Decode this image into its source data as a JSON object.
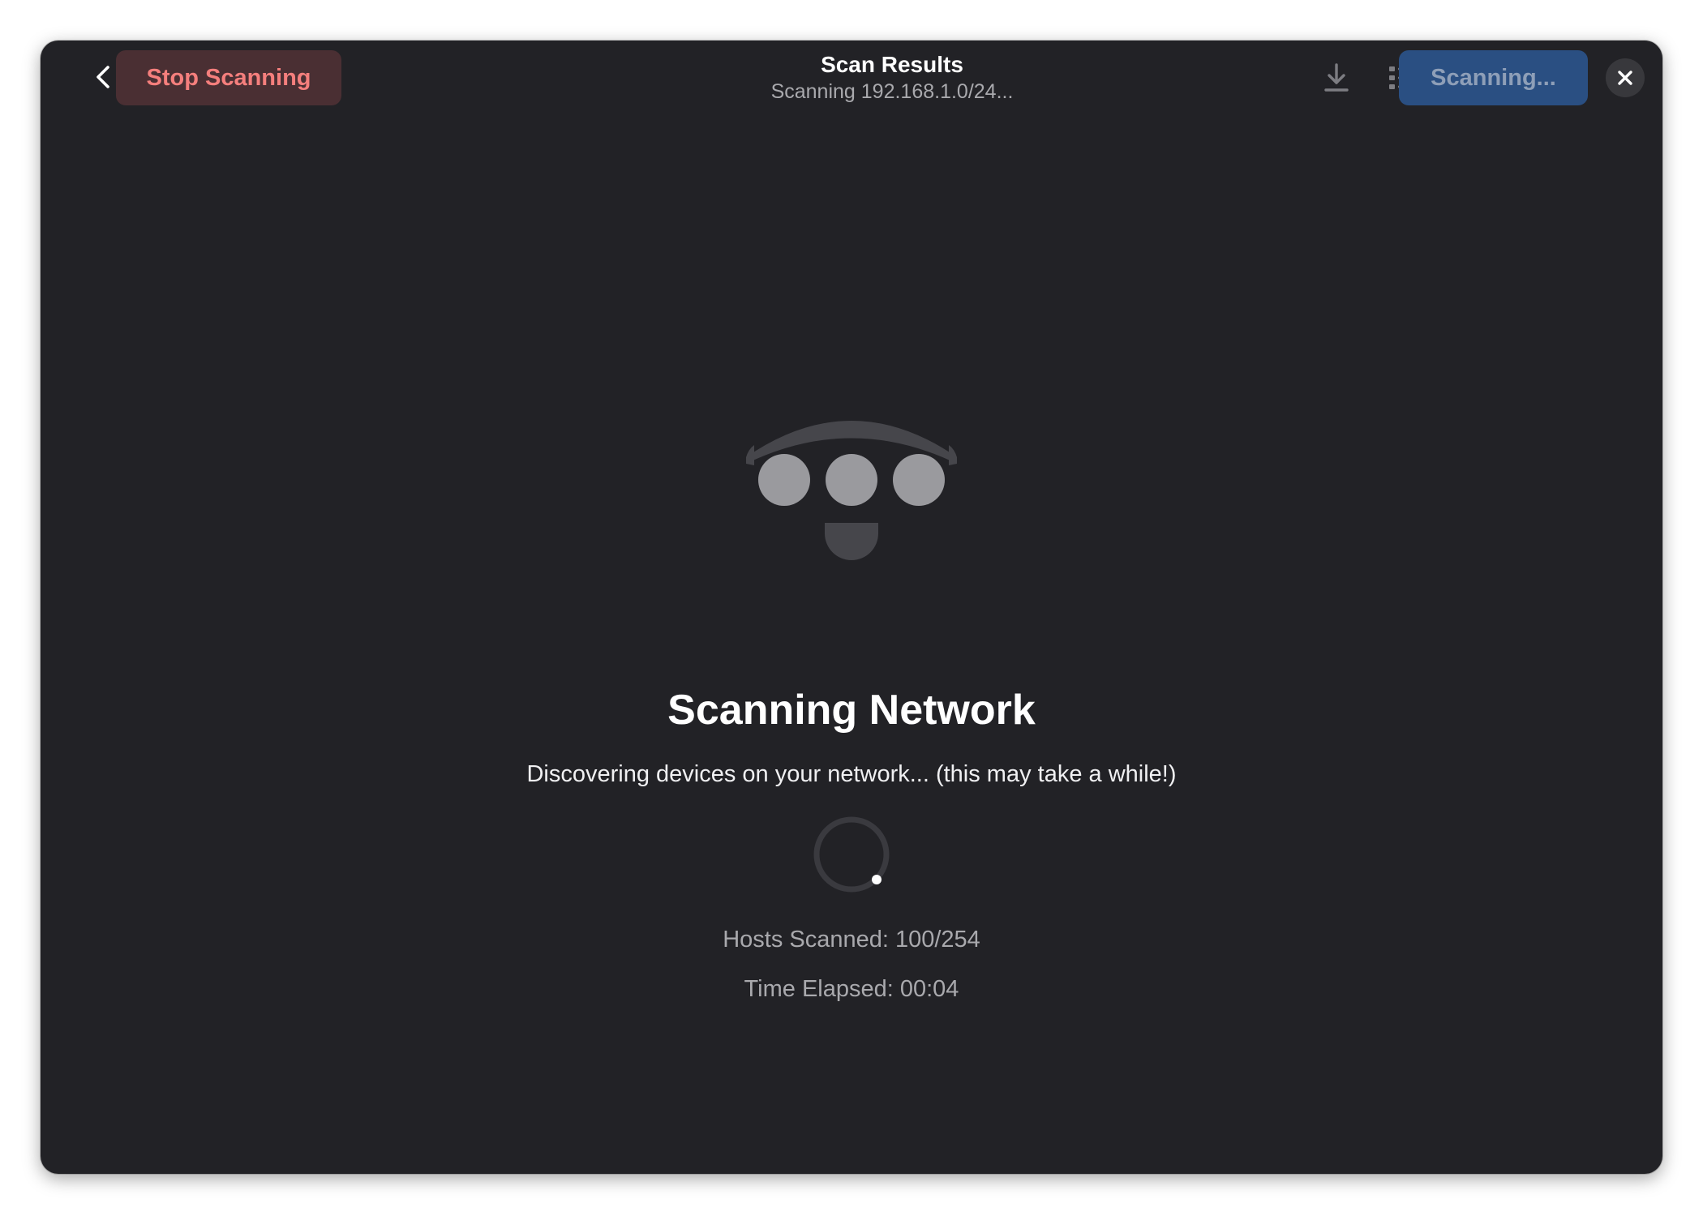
{
  "header": {
    "back_icon": "go-previous-icon",
    "stop_label": "Stop Scanning",
    "title": "Scan Results",
    "subtitle": "Scanning 192.168.1.0/24...",
    "download_icon": "download-icon",
    "list_icon": "view-list-icon",
    "scanning_label": "Scanning...",
    "close_icon": "window-close-icon"
  },
  "status": {
    "icon": "network-wireless-icon",
    "title": "Scanning Network",
    "description": "Discovering devices on your network... (this may take a while!)",
    "hosts_text": "Hosts Scanned: 100/254",
    "elapsed_text": "Time Elapsed: 00:04",
    "hosts_scanned": 100,
    "hosts_total": 254
  },
  "colors": {
    "window_bg": "#222226",
    "stop_bg": "#4a2f33",
    "stop_fg": "#f57f7d",
    "accent_bg": "#2a4f82",
    "accent_fg": "#8e9fb8"
  }
}
